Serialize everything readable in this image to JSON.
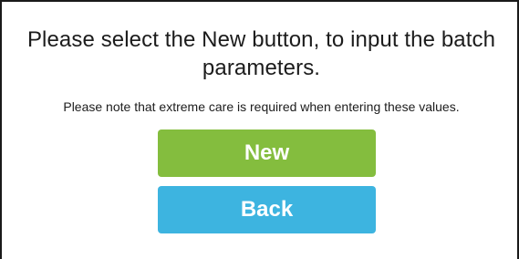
{
  "dialog": {
    "title": "Please select the New button, to input the batch parameters.",
    "note": "Please note that extreme care is required when entering these values.",
    "new_label": "New",
    "back_label": "Back"
  },
  "colors": {
    "new_button": "#84bd3e",
    "back_button": "#3db4e0",
    "text": "#1c1c1c"
  }
}
